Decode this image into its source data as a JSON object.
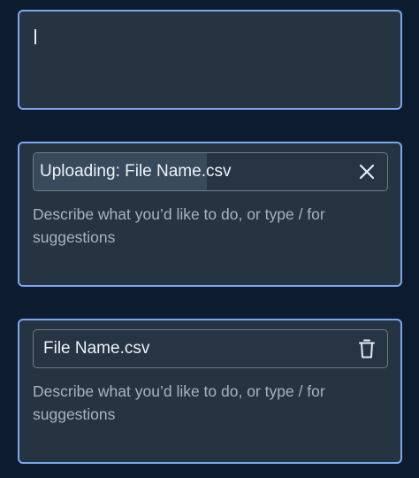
{
  "colors": {
    "background": "#0c1b2d",
    "card_background": "#263341",
    "card_border": "#7aa7f2",
    "chip_border": "#6f7b88",
    "progress_fill": "#3a4a5d",
    "text_primary": "#eef2f7",
    "text_placeholder": "#a9b3bf"
  },
  "empty_input": {
    "value": ""
  },
  "uploading_card": {
    "file_label": "Uploading: File Name.csv",
    "upload_progress": 0.49,
    "action_icon": "close-icon",
    "placeholder": "Describe what you’d like to do, or type / for suggestions"
  },
  "uploaded_card": {
    "file_label": "File Name.csv",
    "action_icon": "trash-icon",
    "placeholder": "Describe what you’d like to do, or type / for suggestions"
  }
}
